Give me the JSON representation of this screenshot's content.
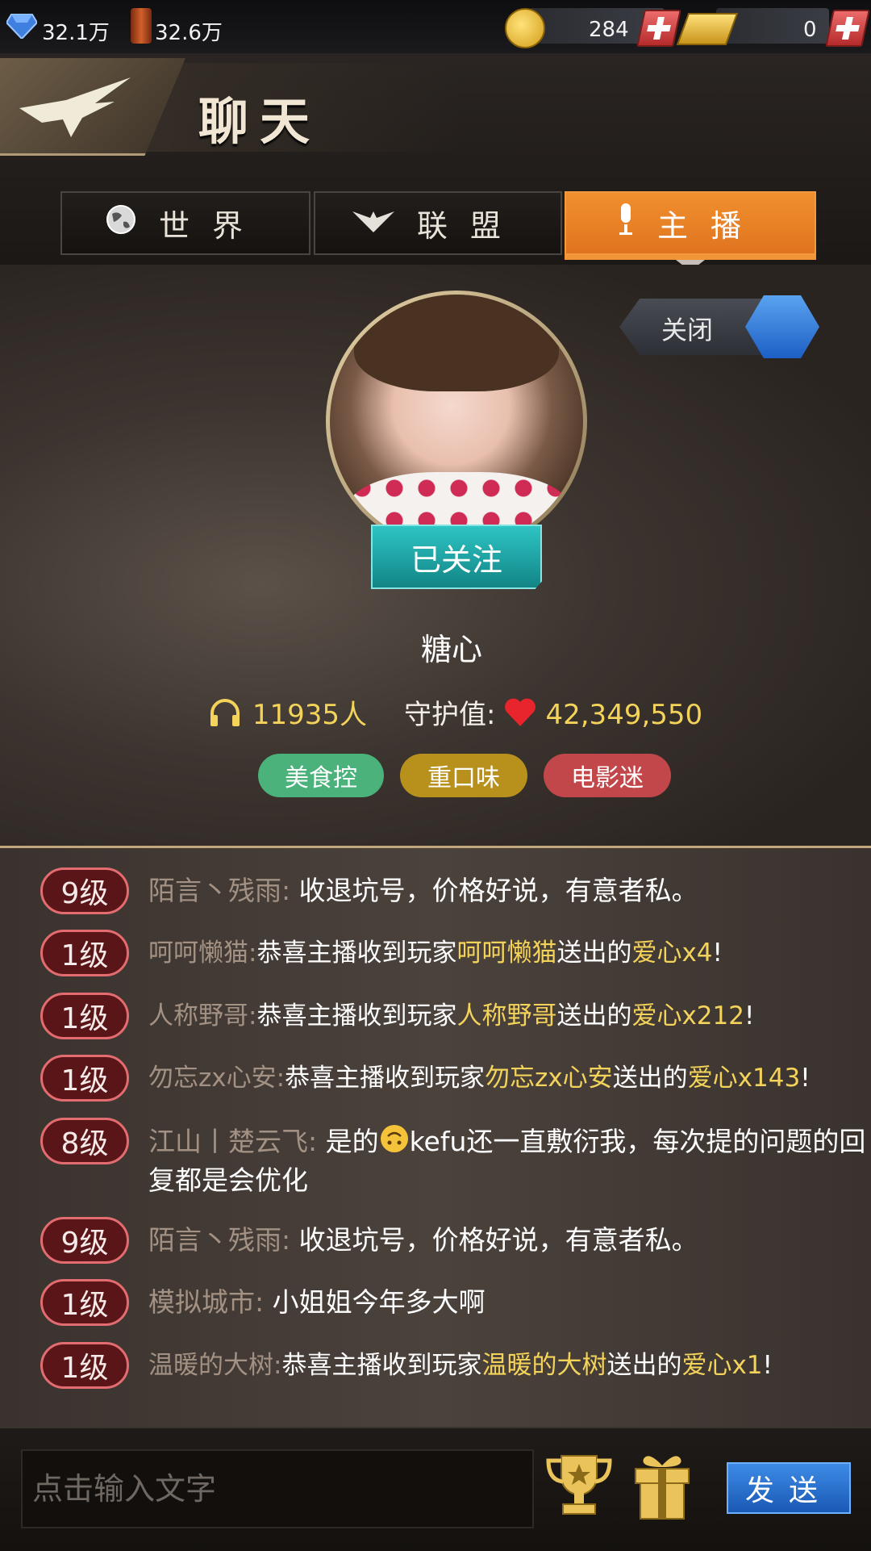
{
  "resources": {
    "gems": "32.1万",
    "oil": "32.6万",
    "coins": "284",
    "gold": "0"
  },
  "header": {
    "title": "聊天"
  },
  "tabs": [
    {
      "label": "世界",
      "icon": "globe-icon"
    },
    {
      "label": "联盟",
      "icon": "wings-icon"
    },
    {
      "label": "主播",
      "icon": "microphone-icon",
      "active": true
    }
  ],
  "streamer": {
    "close_label": "关闭",
    "follow_label": "已关注",
    "name": "糖心",
    "listeners": "11935人",
    "guard_label": "守护值:",
    "guard_value": "42,349,550",
    "tags": [
      {
        "label": "美食控",
        "color": "#4ab27a"
      },
      {
        "label": "重口味",
        "color": "#b8911c"
      },
      {
        "label": "电影迷",
        "color": "#c2474b"
      }
    ]
  },
  "chat": {
    "messages": [
      {
        "level": "9级",
        "user": "陌言丶残雨:",
        "text": "收退坑号，价格好说，有意者私。"
      },
      {
        "level": "1级",
        "user": "呵呵懒猫:",
        "pre": "恭喜主播收到玩家",
        "hl_user": "呵呵懒猫",
        "mid": "送出的",
        "gift": "爱心",
        "count": "x4",
        "end": "!"
      },
      {
        "level": "1级",
        "user": "人称野哥:",
        "pre": "恭喜主播收到玩家",
        "hl_user": "人称野哥",
        "mid": "送出的",
        "gift": "爱心",
        "count": "x212",
        "end": "!"
      },
      {
        "level": "1级",
        "user": "勿忘zx心安:",
        "pre": "恭喜主播收到玩家",
        "hl_user": "勿忘zx心安",
        "mid": "送出的",
        "gift": "爱心",
        "count": "x143",
        "end": "!"
      },
      {
        "level": "8级",
        "user": "江山丨楚云飞:",
        "text_a": "是的",
        "text_b": "kefu还一直敷衍我，每次提的问题的回复都是会优化"
      },
      {
        "level": "9级",
        "user": "陌言丶残雨:",
        "text": "收退坑号，价格好说，有意者私。"
      },
      {
        "level": "1级",
        "user": "模拟城市:",
        "text": "小姐姐今年多大啊"
      },
      {
        "level": "1级",
        "user": "温暖的大树:",
        "pre": "恭喜主播收到玩家",
        "hl_user": "温暖的大树",
        "mid": "送出的",
        "gift": "爱心",
        "count": "x1",
        "end": "!"
      }
    ]
  },
  "input": {
    "placeholder": "点击输入文字",
    "send_label": "发送"
  }
}
